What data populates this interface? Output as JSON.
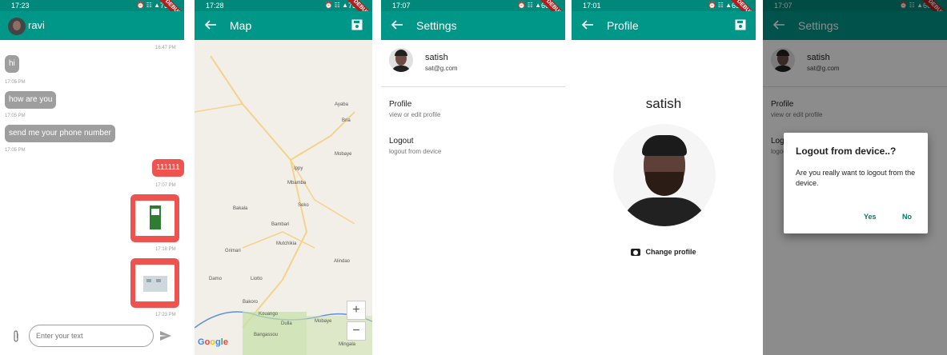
{
  "screens": {
    "chat": {
      "status_time": "17:23",
      "status_battery": "73%",
      "title": "ravi",
      "messages": [
        {
          "time": "16:47 PM",
          "text": ""
        },
        {
          "text": "hi",
          "time": "17:05 PM"
        },
        {
          "text": "how are you",
          "time": "17:05 PM"
        },
        {
          "text": "send me your phone number",
          "time": "17:05 PM"
        },
        {
          "text": "111111",
          "time": "17:07 PM"
        },
        {
          "time": "17:18 PM"
        },
        {
          "time": "17:23 PM"
        }
      ],
      "input_placeholder": "Enter your text"
    },
    "map": {
      "status_time": "17:28",
      "status_battery": "75%",
      "title": "Map",
      "labels": [
        "Ayaba",
        "Bria",
        "Ippy",
        "Bakala",
        "Bambari",
        "Seko",
        "Grimari",
        "Mbamba",
        "Damo",
        "Liotto",
        "Alindao",
        "Mutchikia",
        "Mobaye",
        "Kouango",
        "Bakoro",
        "Dulla",
        "Bangassou",
        "Mobaye",
        "Mingala"
      ],
      "zoom_in": "+",
      "zoom_out": "−",
      "attribution": "Google"
    },
    "settings": {
      "status_time": "17:07",
      "status_battery": "66%",
      "title": "Settings",
      "user_name": "satish",
      "user_email": "sat@g.com",
      "items": [
        {
          "title": "Profile",
          "subtitle": "view or edit profile"
        },
        {
          "title": "Logout",
          "subtitle": "logout from device"
        }
      ]
    },
    "profile": {
      "status_time": "17:01",
      "status_battery": "63%",
      "title": "Profile",
      "name": "satish",
      "change_label": "Change profile"
    },
    "logout_dialog": {
      "status_time": "17:07",
      "status_battery": "66%",
      "title": "Settings",
      "user_name": "satish",
      "user_email": "sat@g.com",
      "items": [
        {
          "title": "Profile",
          "subtitle": "view or edit profile"
        },
        {
          "title": "Logout",
          "subtitle": "logout from device"
        }
      ],
      "dialog_title": "Logout from device..?",
      "dialog_body": "Are you really want to logout from the device.",
      "yes_label": "Yes",
      "no_label": "No"
    }
  },
  "debug_banner": "DEBUG",
  "colors": {
    "appbar": "#009688",
    "statusbar": "#00897b",
    "incoming_bubble": "#9e9e9e",
    "outgoing_bubble": "#ef5350",
    "dialog_button": "#00796b"
  }
}
